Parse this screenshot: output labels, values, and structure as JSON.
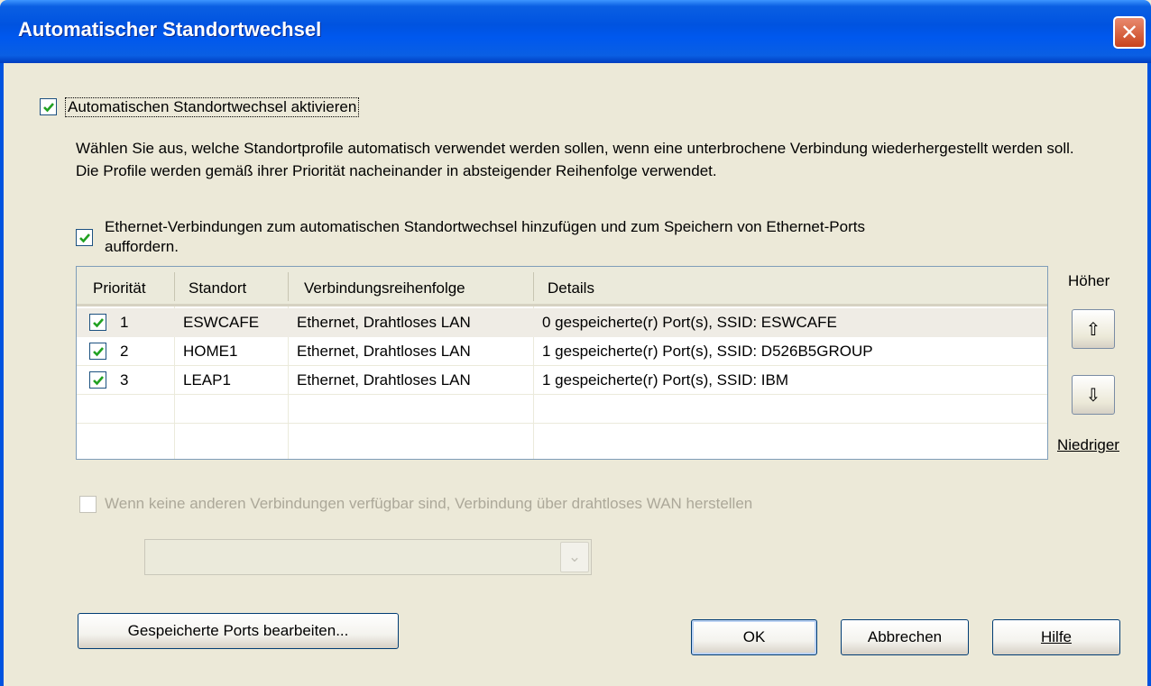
{
  "window": {
    "title": "Automatischer Standortwechsel",
    "close_glyph": "✕"
  },
  "enable_checkbox": {
    "label": "Automatischen Standortwechsel aktivieren",
    "checked": true
  },
  "description": "Wählen Sie aus, welche Standortprofile automatisch verwendet werden sollen, wenn eine unterbrochene Verbindung wiederhergestellt werden soll. Die Profile werden gemäß ihrer Priorität nacheinander in absteigender Reihenfolge verwendet.",
  "ethernet_checkbox": {
    "label_line1": "Ethernet-Verbindungen zum automatischen Standortwechsel hinzufügen und zum Speichern von Ethernet-Ports",
    "label_line2": "auffordern.",
    "checked": true
  },
  "table": {
    "headers": [
      "Priorität",
      "Standort",
      "Verbindungsreihenfolge",
      "Details"
    ],
    "rows": [
      {
        "checked": true,
        "priority": "1",
        "location": "ESWCAFE",
        "order": "Ethernet, Drahtloses LAN",
        "details": "0 gespeicherte(r) Port(s),  SSID: ESWCAFE"
      },
      {
        "checked": true,
        "priority": "2",
        "location": "HOME1",
        "order": "Ethernet, Drahtloses LAN",
        "details": "1 gespeicherte(r) Port(s),  SSID: D526B5GROUP"
      },
      {
        "checked": true,
        "priority": "3",
        "location": "LEAP1",
        "order": "Ethernet, Drahtloses LAN",
        "details": "1 gespeicherte(r) Port(s),  SSID: IBM"
      }
    ]
  },
  "priority_controls": {
    "higher_label": "Höher",
    "lower_label": "Niedriger",
    "up_glyph": "⇧",
    "down_glyph": "⇩"
  },
  "wan_checkbox": {
    "label": "Wenn keine anderen Verbindungen verfügbar sind, Verbindung über drahtloses WAN herstellen",
    "checked": false,
    "enabled": false
  },
  "wan_combo": {
    "value": "",
    "arrow_glyph": "⌄"
  },
  "buttons": {
    "edit_ports": "Gespeicherte Ports bearbeiten...",
    "ok": "OK",
    "cancel": "Abbrechen",
    "help": "Hilfe"
  },
  "colors": {
    "title_bar": "#0053e0",
    "dialog_bg": "#ece9d8",
    "check_green": "#21a121",
    "close_red": "#c8431d"
  }
}
